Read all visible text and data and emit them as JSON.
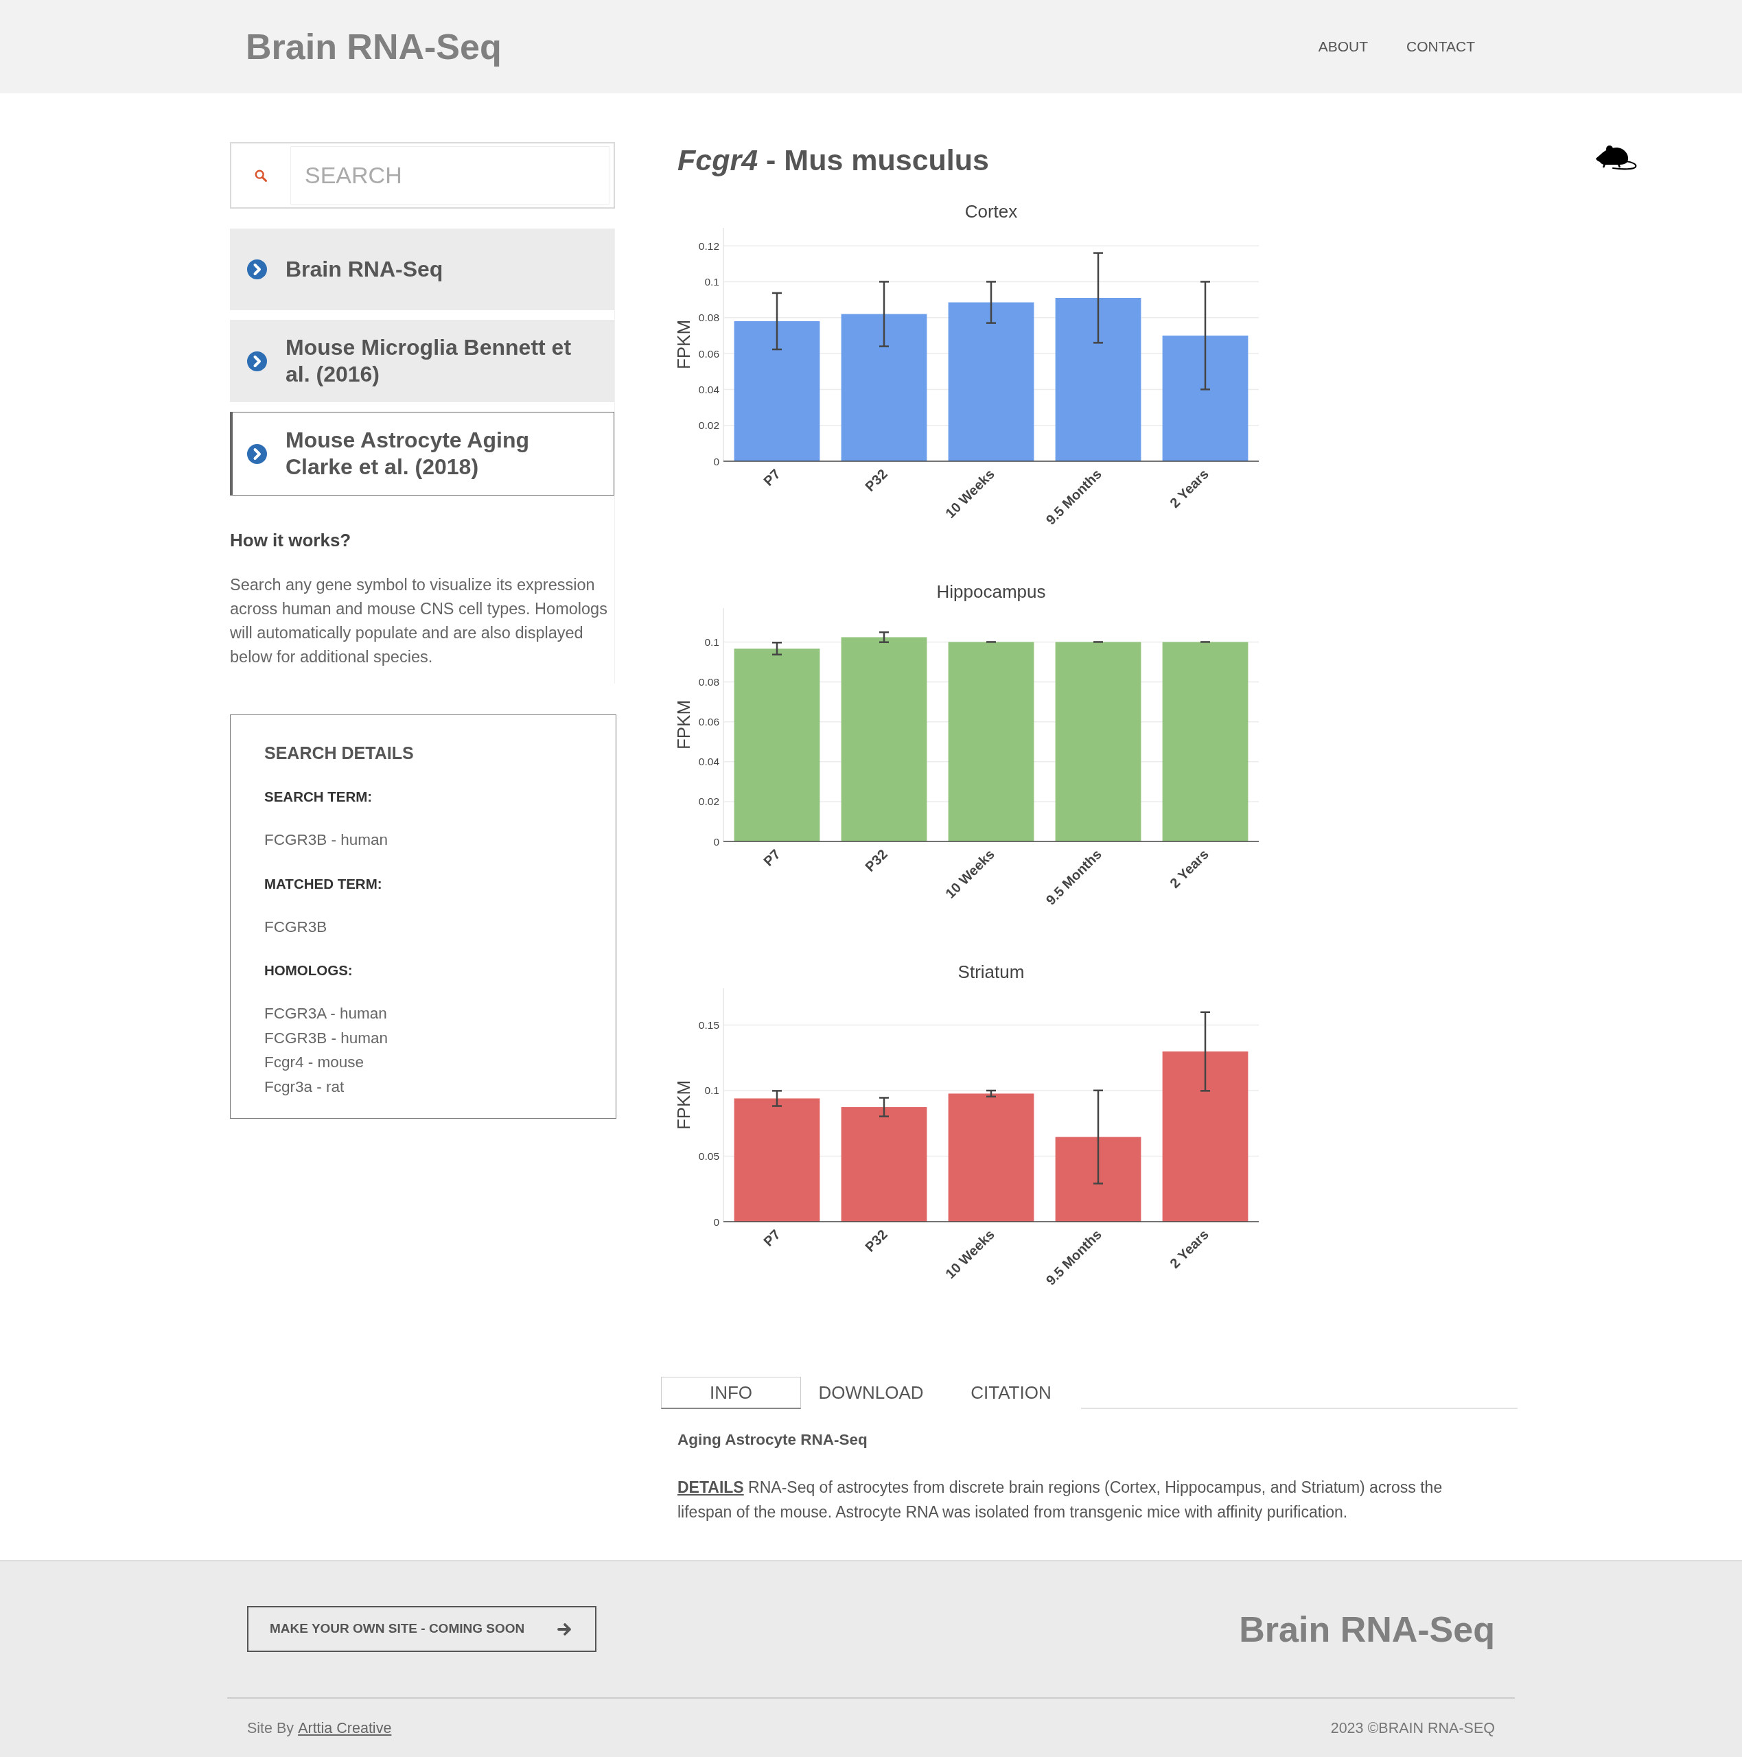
{
  "header": {
    "logo": "Brain RNA-Seq",
    "nav": [
      "ABOUT",
      "CONTACT"
    ]
  },
  "sidebar": {
    "search": {
      "placeholder": "SEARCH"
    },
    "datasets": [
      {
        "label": "Brain RNA-Seq",
        "selected": false
      },
      {
        "label": "Mouse Microglia Bennett et al. (2016)",
        "selected": false
      },
      {
        "label": "Mouse Astrocyte Aging Clarke et al. (2018)",
        "selected": true
      }
    ],
    "help": {
      "title": "How it works?",
      "text": "Search any gene symbol to visualize its expression across human and mouse CNS cell types. Homologs will automatically populate and are also displayed below for additional species."
    },
    "search_details": {
      "title": "SEARCH DETAILS",
      "fields": [
        {
          "label": "SEARCH TERM:",
          "values": [
            "FCGR3B - human"
          ]
        },
        {
          "label": "MATCHED TERM:",
          "values": [
            "FCGR3B"
          ]
        },
        {
          "label": "HOMOLOGS:",
          "values": [
            "FCGR3A - human",
            "FCGR3B - human",
            "Fcgr4 - mouse",
            "Fcgr3a - rat"
          ]
        }
      ]
    }
  },
  "gene": {
    "title": "*Fcgr4* - Mus musculus",
    "charts": [
      {
        "chart_data": {
          "type": "bar",
          "title": "Cortex",
          "ylabel": "FPKM",
          "categories": [
            "P7",
            "P32",
            "10 Weeks",
            "9.5 Months",
            "2 Years"
          ],
          "series": [
            {
              "color": "#6d9eeb",
              "values": [
                0.078,
                0.082,
                0.0885,
                0.091,
                0.07
              ],
              "errors": [
                0.0157,
                0.018,
                0.0115,
                0.025,
                0.03
              ]
            }
          ],
          "ylim": [
            0,
            0.13
          ],
          "yticks": [
            0,
            0.02,
            0.04,
            0.06,
            0.08,
            0.1,
            0.12
          ],
          "grid": true
        }
      },
      {
        "chart_data": {
          "type": "bar",
          "title": "Hippocampus",
          "ylabel": "FPKM",
          "categories": [
            "P7",
            "P32",
            "10 Weeks",
            "9.5 Months",
            "2 Years"
          ],
          "series": [
            {
              "color": "#93c47d",
              "values": [
                0.0967,
                0.1024,
                0.1,
                0.1,
                0.1
              ],
              "errors": [
                0.003,
                0.0025,
                0,
                0,
                0
              ]
            }
          ],
          "ylim": [
            0,
            0.117
          ],
          "yticks": [
            0,
            0.02,
            0.04,
            0.06,
            0.08,
            0.1
          ],
          "grid": true
        }
      },
      {
        "chart_data": {
          "type": "bar",
          "title": "Striatum",
          "ylabel": "FPKM",
          "categories": [
            "P7",
            "P32",
            "10 Weeks",
            "9.5 Months",
            "2 Years"
          ],
          "series": [
            {
              "color": "#e06666",
              "values": [
                0.094,
                0.0874,
                0.0977,
                0.0646,
                0.1298
              ],
              "errors": [
                0.0058,
                0.0071,
                0.0023,
                0.0355,
                0.03
              ]
            }
          ],
          "ylim": [
            0,
            0.178
          ],
          "yticks": [
            0,
            0.05,
            0.1,
            0.15
          ],
          "grid": true
        }
      }
    ]
  },
  "tabs": [
    {
      "label": "INFO",
      "selected": true
    },
    {
      "label": "DOWNLOAD",
      "selected": false
    },
    {
      "label": "CITATION",
      "selected": false
    }
  ],
  "info": {
    "title": "Aging Astrocyte RNA-Seq",
    "details": "**DETAILS** RNA-Seq of astrocytes from discrete brain regions (Cortex, Hippocampus, and Striatum) across the lifespan of the mouse. Astrocyte RNA was isolated from transgenic mice with affinity purification."
  },
  "footer": {
    "button": "MAKE YOUR OWN SITE - COMING SOON",
    "logo": "Brain RNA-Seq",
    "credit": "Site By",
    "credit_link": "Arttia Creative",
    "copyright": "2023 ©BRAIN RNA-SEQ"
  }
}
